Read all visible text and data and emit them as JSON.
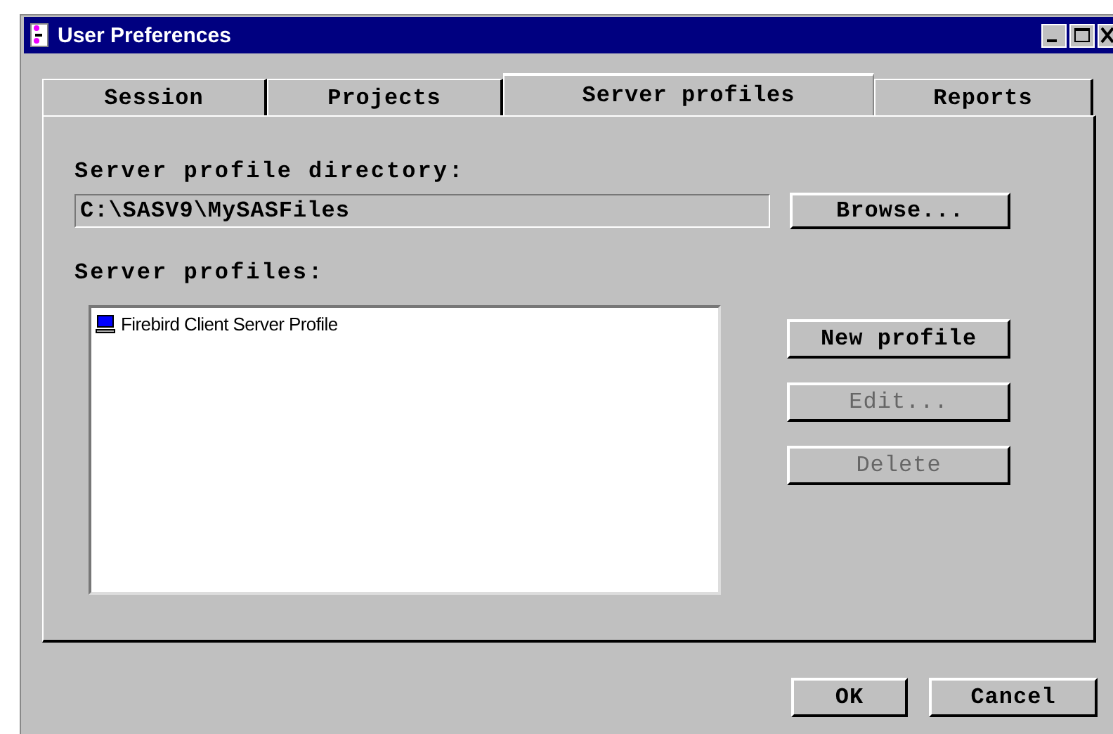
{
  "window": {
    "title": "User Preferences"
  },
  "tabs": [
    {
      "label": "Session",
      "selected": false
    },
    {
      "label": "Projects",
      "selected": false
    },
    {
      "label": "Server profiles",
      "selected": true
    },
    {
      "label": "Reports",
      "selected": false
    }
  ],
  "directory": {
    "label": "Server profile directory:",
    "value": "C:\\SASV9\\MySASFiles",
    "browse_button": "Browse..."
  },
  "profiles": {
    "label": "Server profiles:",
    "items": [
      {
        "name": "Firebird Client Server Profile"
      }
    ]
  },
  "profile_buttons": [
    {
      "label": "New profile",
      "disabled": false
    },
    {
      "label": "Edit...",
      "disabled": true
    },
    {
      "label": "Delete",
      "disabled": true
    }
  ],
  "buttons": [
    {
      "label": "OK"
    },
    {
      "label": "Cancel"
    }
  ]
}
